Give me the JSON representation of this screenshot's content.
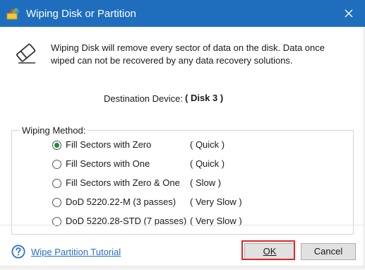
{
  "window": {
    "title": "Wiping Disk or Partition",
    "close_icon": "close-icon",
    "accent_color": "#1f6ebe"
  },
  "message": {
    "icon": "eraser-icon",
    "text": "Wiping Disk will remove every sector of data on the disk. Data once wiped can not be recovered by any data recovery solutions."
  },
  "destination": {
    "label": "Destination Device:",
    "value": "( Disk 3 )"
  },
  "wiping_method": {
    "label": "Wiping Method:",
    "options": [
      {
        "label": "Fill Sectors with Zero",
        "speed": "( Quick )",
        "selected": true
      },
      {
        "label": "Fill Sectors with One",
        "speed": "( Quick )",
        "selected": false
      },
      {
        "label": "Fill Sectors with Zero & One",
        "speed": "( Slow )",
        "selected": false
      },
      {
        "label": "DoD 5220.22-M (3 passes)",
        "speed": "( Very Slow )",
        "selected": false
      },
      {
        "label": "DoD 5220.28-STD (7 passes)",
        "speed": "( Very Slow )",
        "selected": false
      }
    ]
  },
  "footer": {
    "help_icon": "question-icon",
    "tutorial_link": "Wipe Partition Tutorial",
    "ok_label": "OK",
    "cancel_label": "Cancel",
    "highlight_color": "#e0262a"
  }
}
